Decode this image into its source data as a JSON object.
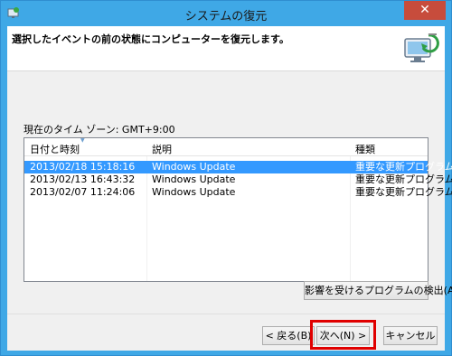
{
  "window": {
    "title": "システムの復元",
    "close_glyph": "✕"
  },
  "header": {
    "instruction": "選択したイベントの前の状態にコンピューターを復元します。"
  },
  "timezone": {
    "label": "現在のタイム ゾーン: GMT+9:00"
  },
  "table": {
    "columns": [
      "日付と時刻",
      "説明",
      "種類"
    ],
    "rows": [
      {
        "date": "2013/02/18 15:18:16",
        "description": "Windows Update",
        "type": "重要な更新プログラム",
        "selected": true
      },
      {
        "date": "2013/02/13 16:43:32",
        "description": "Windows Update",
        "type": "重要な更新プログラム",
        "selected": false
      },
      {
        "date": "2013/02/07 11:24:06",
        "description": "Windows Update",
        "type": "重要な更新プログラム",
        "selected": false
      }
    ]
  },
  "buttons": {
    "scan": "影響を受けるプログラムの検出(A)",
    "back": "< 戻る(B)",
    "next": "次へ(N) >",
    "cancel": "キャンセル"
  },
  "colors": {
    "titlebar": "#3fa8e6",
    "selection": "#3399ff",
    "highlight": "#e00000",
    "close": "#c74c3c"
  },
  "icons": {
    "title": "system-restore-icon",
    "header": "restore-monitor-icon",
    "sort": "sort-indicator-icon"
  }
}
